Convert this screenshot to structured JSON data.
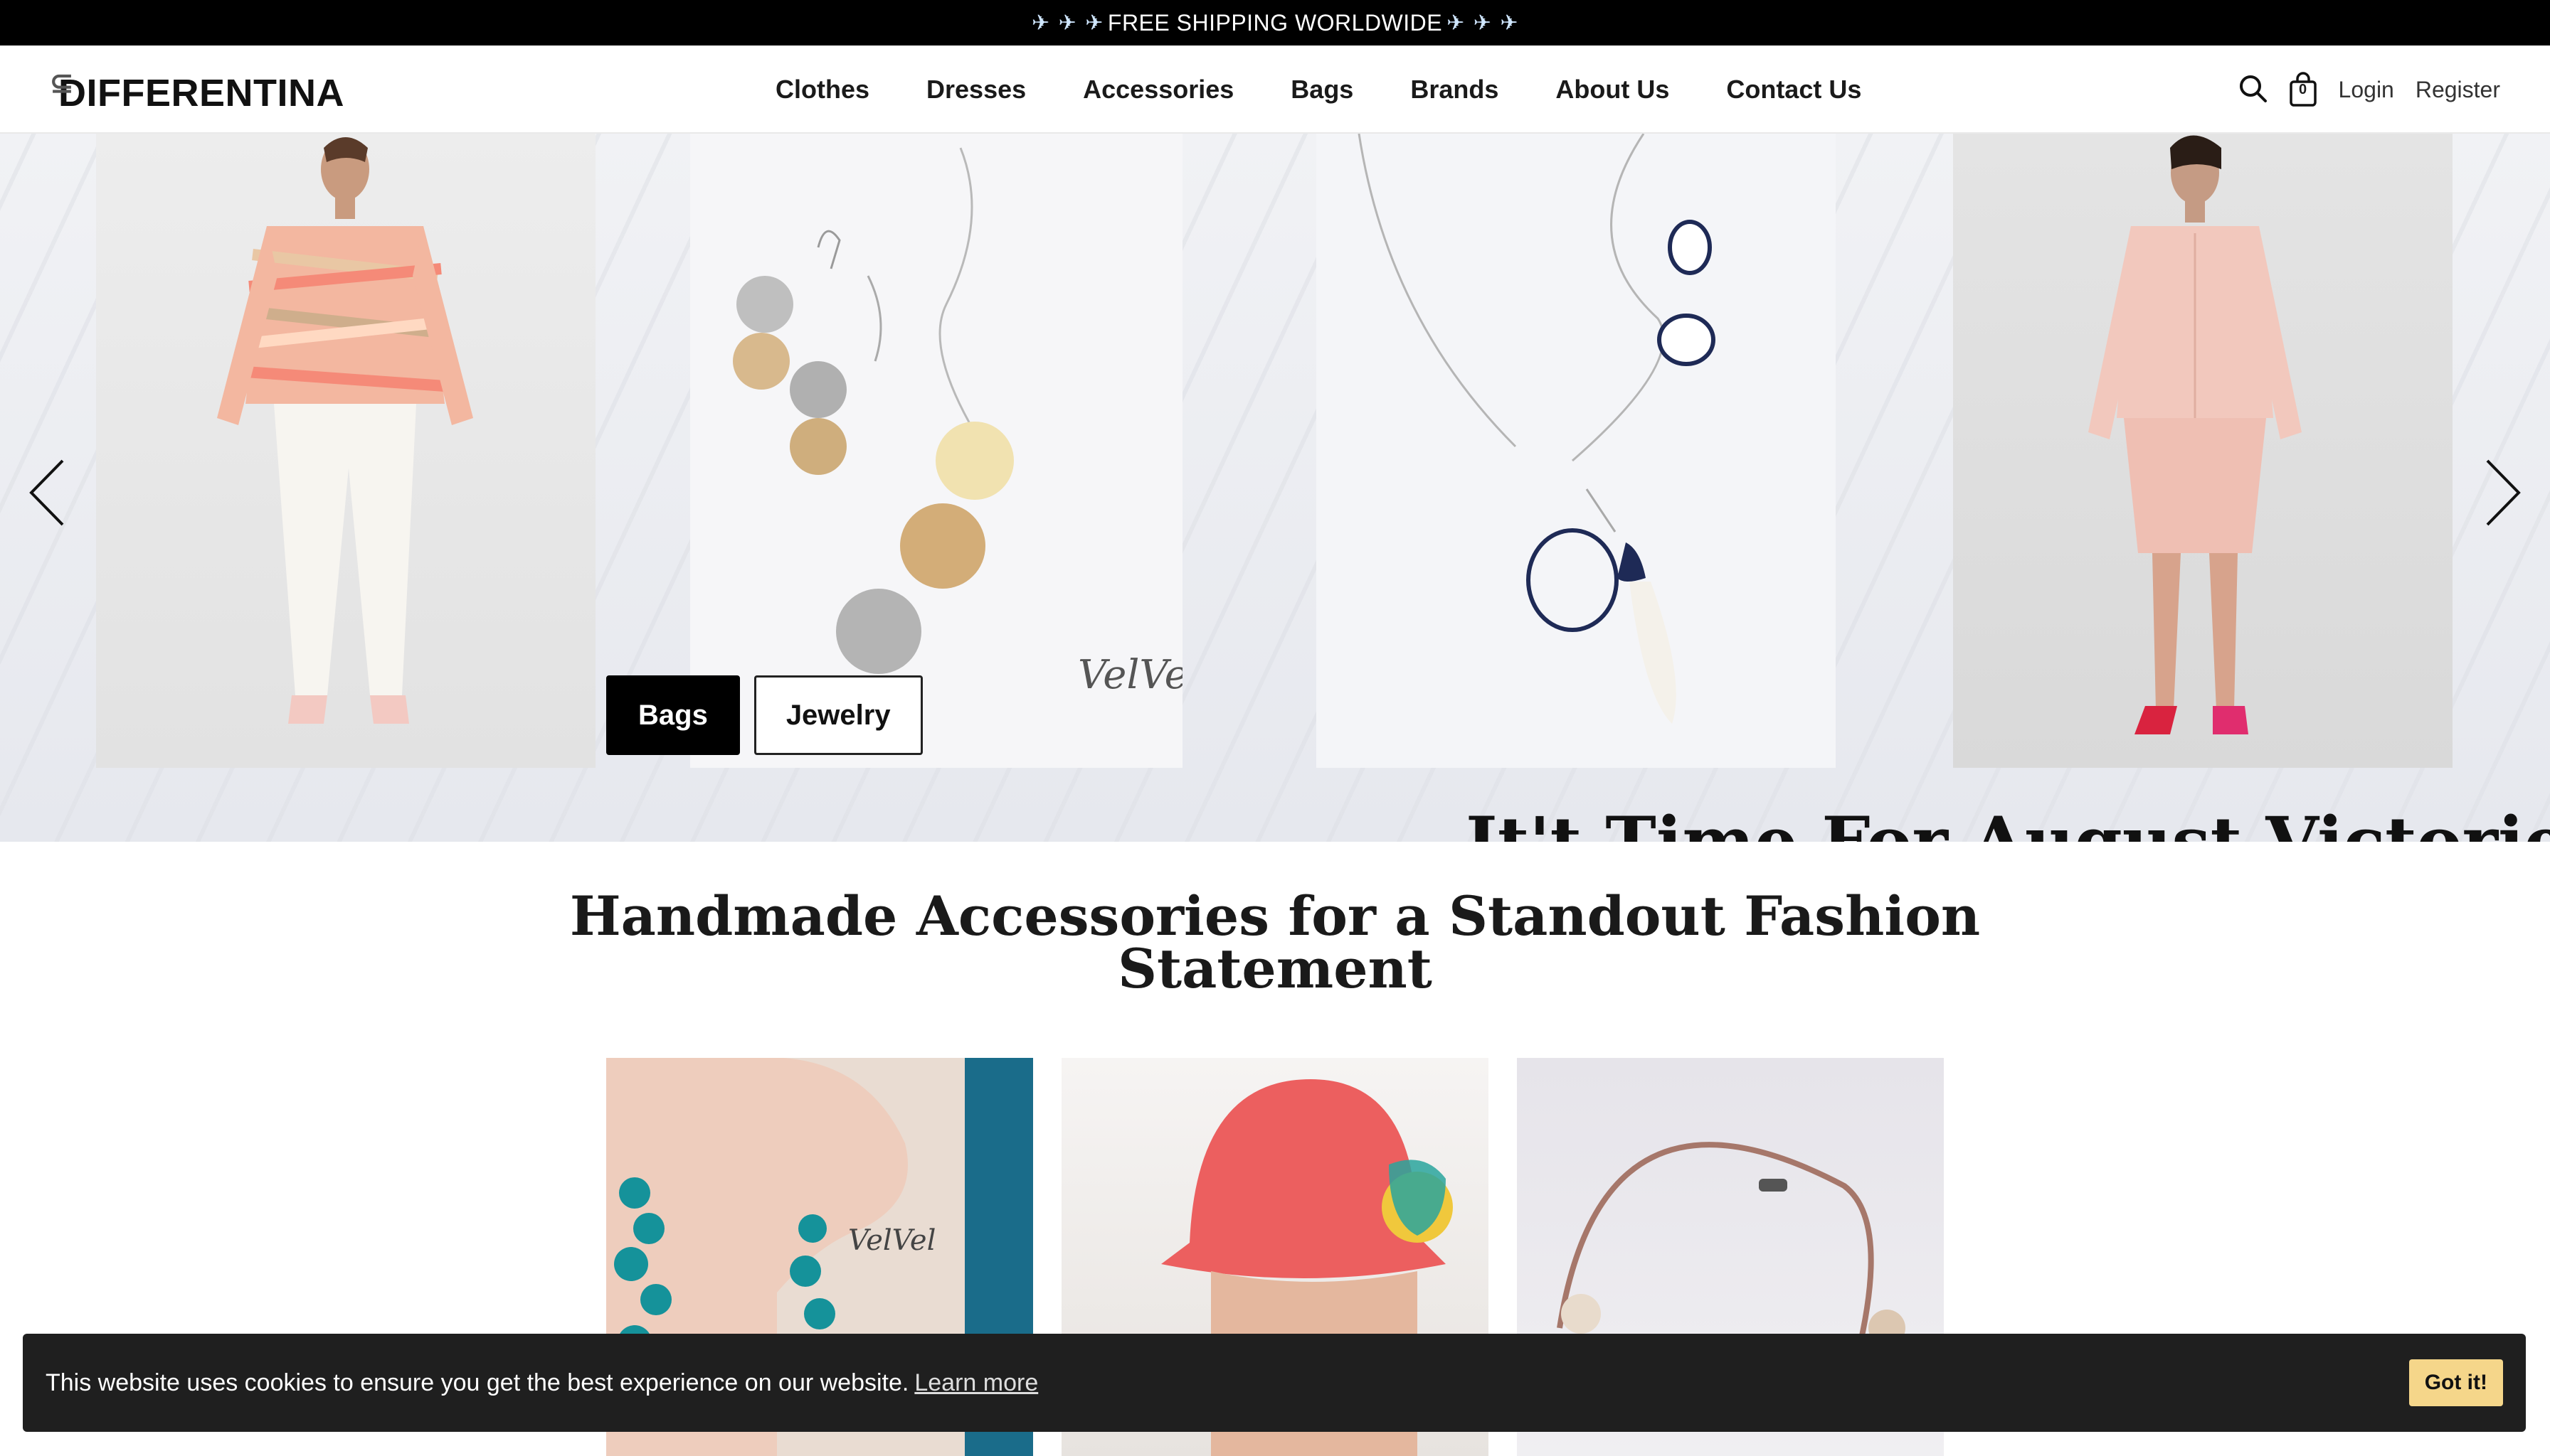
{
  "announcement": {
    "text": "FREE SHIPPING WORLDWIDE",
    "icon": "airplane-icon"
  },
  "header": {
    "logo_text": "DIFFERENTINA",
    "nav": [
      "Clothes",
      "Dresses",
      "Accessories",
      "Bags",
      "Brands",
      "About Us",
      "Contact Us"
    ],
    "login": "Login",
    "register": "Register",
    "cart_count": "0"
  },
  "hero": {
    "buttons": [
      "Bags",
      "Jewelry"
    ],
    "promo_text": "It't Time For August Victories!",
    "arrows": [
      "chevron-left-icon",
      "chevron-right-icon"
    ]
  },
  "section": {
    "title_line1": "Handmade Accessories for a Standout Fashion",
    "title_line2": "Statement"
  },
  "cookie": {
    "message": "This website uses cookies to ensure you get the best experience on our website.",
    "learn_more": "Learn more",
    "accept": "Got it!"
  },
  "colors": {
    "announcement_bg": "#000000",
    "cookie_bg": "#1f1f1f",
    "cookie_button": "#f5d68a"
  }
}
